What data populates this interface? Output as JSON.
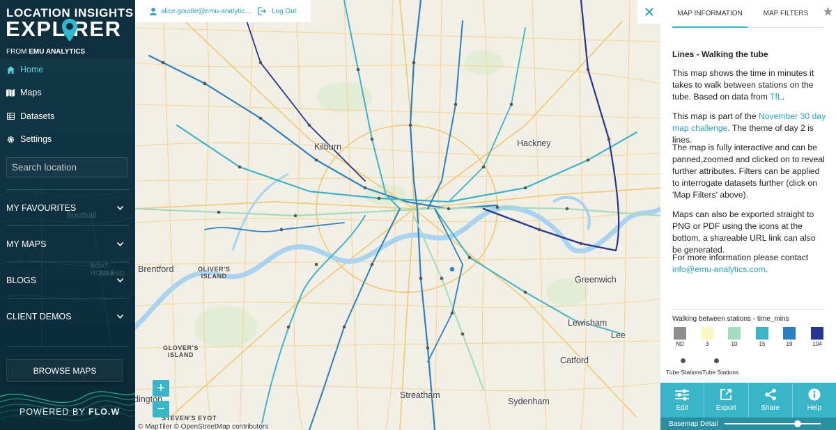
{
  "app": {
    "logo_line1": "LOCATION INSIGHTS",
    "logo_line2": "EXPL  RER",
    "logo_from": "FROM",
    "logo_from_brand": "EMU ANALYTICS"
  },
  "sidebar": {
    "nav": [
      {
        "label": "Home",
        "icon": "home-icon"
      },
      {
        "label": "Maps",
        "icon": "map-icon"
      },
      {
        "label": "Datasets",
        "icon": "table-icon"
      },
      {
        "label": "Settings",
        "icon": "gear-icon"
      }
    ],
    "search_placeholder": "Search location",
    "sections": [
      {
        "label": "MY FAVOURITES"
      },
      {
        "label": "MY MAPS"
      },
      {
        "label": "BLOGS"
      },
      {
        "label": "CLIENT DEMOS"
      }
    ],
    "browse_label": "BROWSE MAPS",
    "powered_by": "POWERED BY",
    "powered_brand": "FLO.W",
    "ghost_labels": {
      "southall": "Southall",
      "boat_house": "BOAT HOUSE",
      "island": "ISLAND"
    }
  },
  "topbar": {
    "user_email": "alice.goudie@emu-analytics.com",
    "logout_label": "Log Out"
  },
  "map": {
    "places": {
      "kilburn": "Kilburn",
      "hackney": "Hackney",
      "brentford": "Brentford",
      "greenwich": "Greenwich",
      "lewisham": "Lewisham",
      "lee": "Lee",
      "catford": "Catford",
      "streatham": "Streatham",
      "sydenham": "Sydenham",
      "addington": "dington"
    },
    "islands": {
      "olivers1": "OLIVER'S",
      "olivers2": "ISLAND",
      "glovers1": "GLOVER'S",
      "glovers2": "ISLAND",
      "stevens": "STEVEN'S EYOT"
    },
    "attribution": "© MapTiler © OpenStreetMap contributors",
    "zoom_in": "+",
    "zoom_out": "−"
  },
  "panel": {
    "tabs": [
      "MAP INFORMATION",
      "MAP FILTERS"
    ],
    "title": "Lines - Walking the tube",
    "p1_text": "This map shows the time in minutes it takes to walk between stations on the tube. Based on data from ",
    "p1_link": "TfL",
    "p1_end": ".",
    "p2_text": "This map is part of the ",
    "p2_link": "November 30 day map challenge",
    "p2_end": ". The theme of day 2 is lines.",
    "p3": "The map is fully interactive and can be panned,zoomed and clicked on to reveal further attributes. Filters can be applied to interrogate datasets further (click on 'Map Filters' above).",
    "p4": "Maps can also be exported straight to PNG or PDF using the icons at the bottom, a shareable URL link can also be generated.",
    "p5_text": "For more information please contact ",
    "p5_link": "info@emu-analytics.com",
    "p5_end": ".",
    "legend": {
      "title": "Walking between stations - time_mins",
      "items": [
        {
          "label": "ND",
          "color": "#8e8e8e"
        },
        {
          "label": "3",
          "color": "#fbf8c6"
        },
        {
          "label": "10",
          "color": "#a3dcbc"
        },
        {
          "label": "15",
          "color": "#3db4c6"
        },
        {
          "label": "19",
          "color": "#2d80bd"
        },
        {
          "label": "104",
          "color": "#24368f"
        }
      ],
      "dots_label": "Tube StationsTube Stations"
    },
    "toolbar": [
      {
        "label": "Edit",
        "icon": "sliders-icon"
      },
      {
        "label": "Export",
        "icon": "export-icon"
      },
      {
        "label": "Share",
        "icon": "share-icon"
      },
      {
        "label": "Help",
        "icon": "info-icon"
      }
    ],
    "basemap_label": "Basemap Detail",
    "basemap_value": 0.78
  },
  "colors": {
    "accent": "#3ab5c7",
    "sidebar_bg": "#0f3242",
    "road": "#f5cf7e",
    "water": "#a9d3ee"
  }
}
